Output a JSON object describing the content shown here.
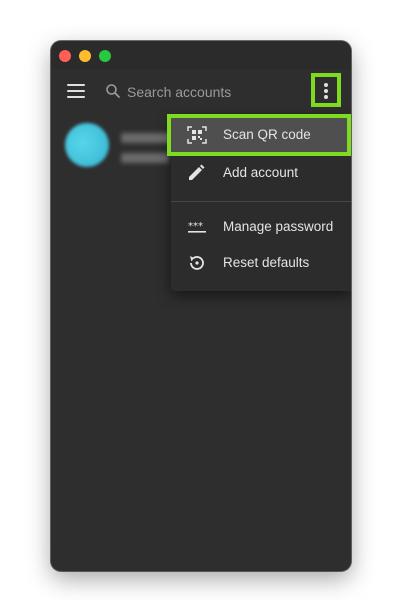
{
  "search": {
    "placeholder": "Search accounts"
  },
  "menu": {
    "items": [
      {
        "label": "Scan QR code",
        "icon": "qr-scan-icon"
      },
      {
        "label": "Add account",
        "icon": "pencil-icon"
      },
      {
        "label": "Manage password",
        "icon": "password-icon"
      },
      {
        "label": "Reset defaults",
        "icon": "reset-icon"
      }
    ]
  },
  "colors": {
    "window_bg": "#2e2e2e",
    "menu_bg": "#2c2c2c",
    "highlight_outline": "#7ddc1f",
    "avatar": "#44c3dc"
  }
}
